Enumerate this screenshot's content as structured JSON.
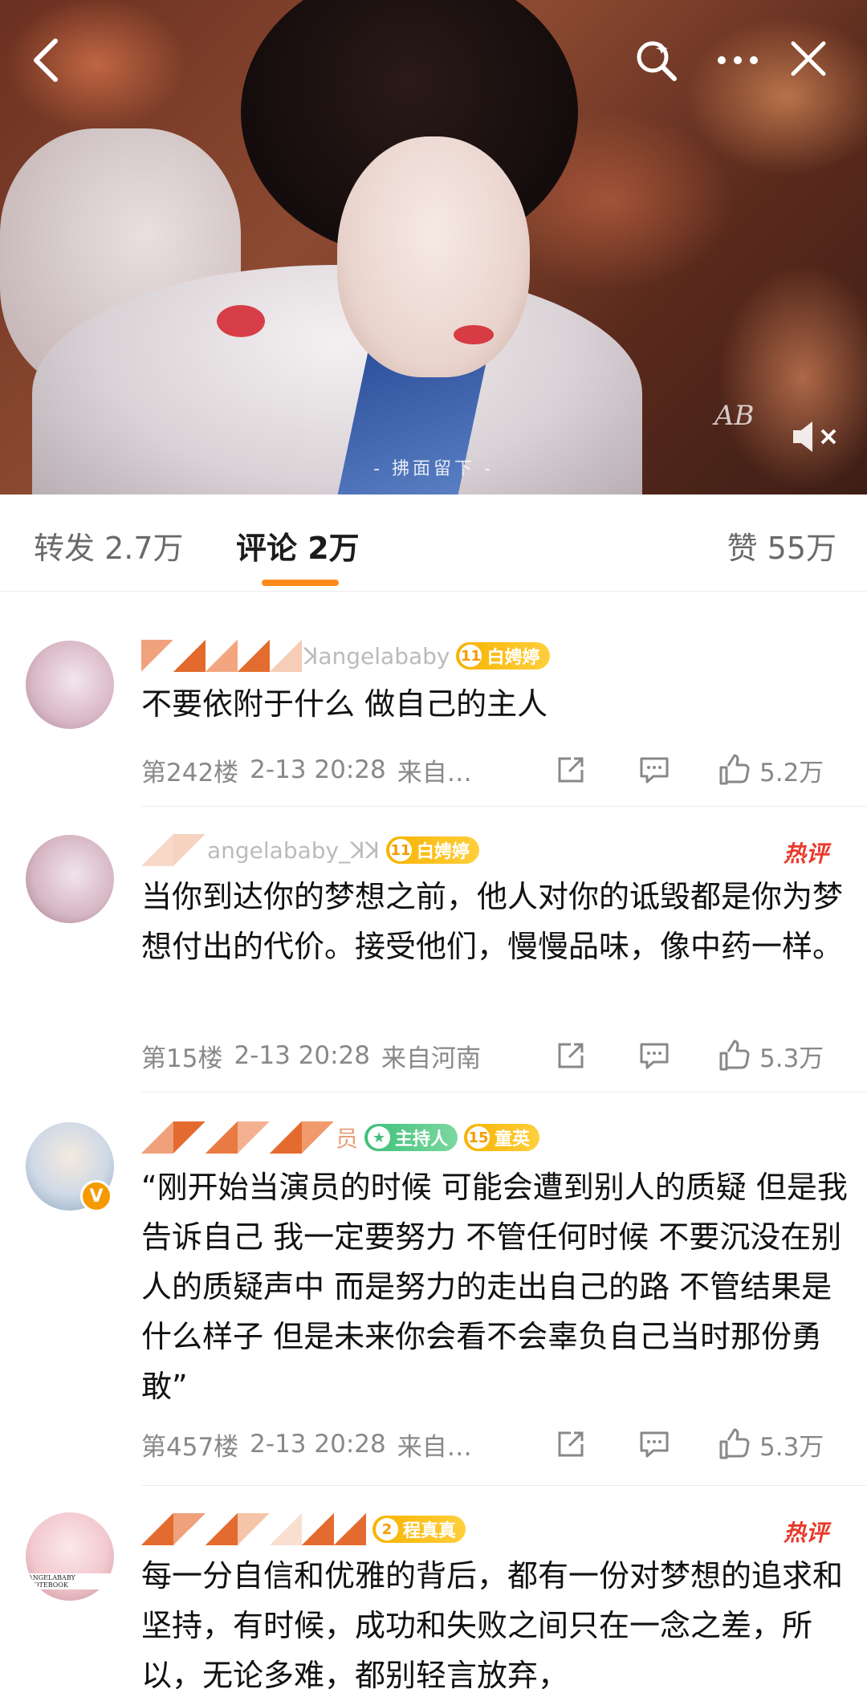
{
  "video": {
    "subtitle": "- 拂面留下 -",
    "watermark": "AB"
  },
  "tabs": {
    "repost": "转发 2.7万",
    "comment": "评论 2万",
    "like": "赞 55万"
  },
  "comments": [
    {
      "username": "ꓘangelababy",
      "badge_level": "11",
      "badge_text": "白娉婷",
      "hot": "",
      "text": "不要依附于什么 做自己的主人",
      "floor": "第242楼",
      "time": "2-13 20:28",
      "location": "来自…",
      "likes": "5.2万"
    },
    {
      "username": "angelababy_ꓘꓘ",
      "badge_level": "11",
      "badge_text": "白娉婷",
      "hot": "热评",
      "text": "当你到达你的梦想之前，他人对你的诋毁都是你为梦想付出的代价。接受他们，慢慢品味，像中药一样。",
      "floor": "第15楼",
      "time": "2-13 20:28",
      "location": "来自河南",
      "likes": "5.3万"
    },
    {
      "username": "员",
      "badge_host": "主持人",
      "badge_level": "15",
      "badge_text": "童英",
      "hot": "",
      "text": "“刚开始当演员的时候 可能会遭到别人的质疑 但是我告诉自己 我一定要努力 不管任何时候 不要沉没在别人的质疑声中 而是努力的走出自己的路 不管结果是什么样子 但是未来你会看不会辜负自己当时那份勇敢”",
      "floor": "第457楼",
      "time": "2-13 20:28",
      "location": "来自…",
      "likes": "5.3万"
    },
    {
      "username": "",
      "badge_level": "2",
      "badge_text": "程真真",
      "hot": "热评",
      "avatar_text": "ANGELABABY NOTEBOOK",
      "text": "每一分自信和优雅的背后，都有一份对梦想的追求和坚持，有时候，成功和失败之间只在一念之差，所以，无论多难，都别轻言放弃，",
      "floor": "",
      "time": "",
      "location": "",
      "likes": ""
    }
  ],
  "colors": {
    "accent": "#ff8a1a",
    "hot": "#e83a2c",
    "badge_gold": "#f7b200",
    "badge_green": "#3fbf7a"
  }
}
